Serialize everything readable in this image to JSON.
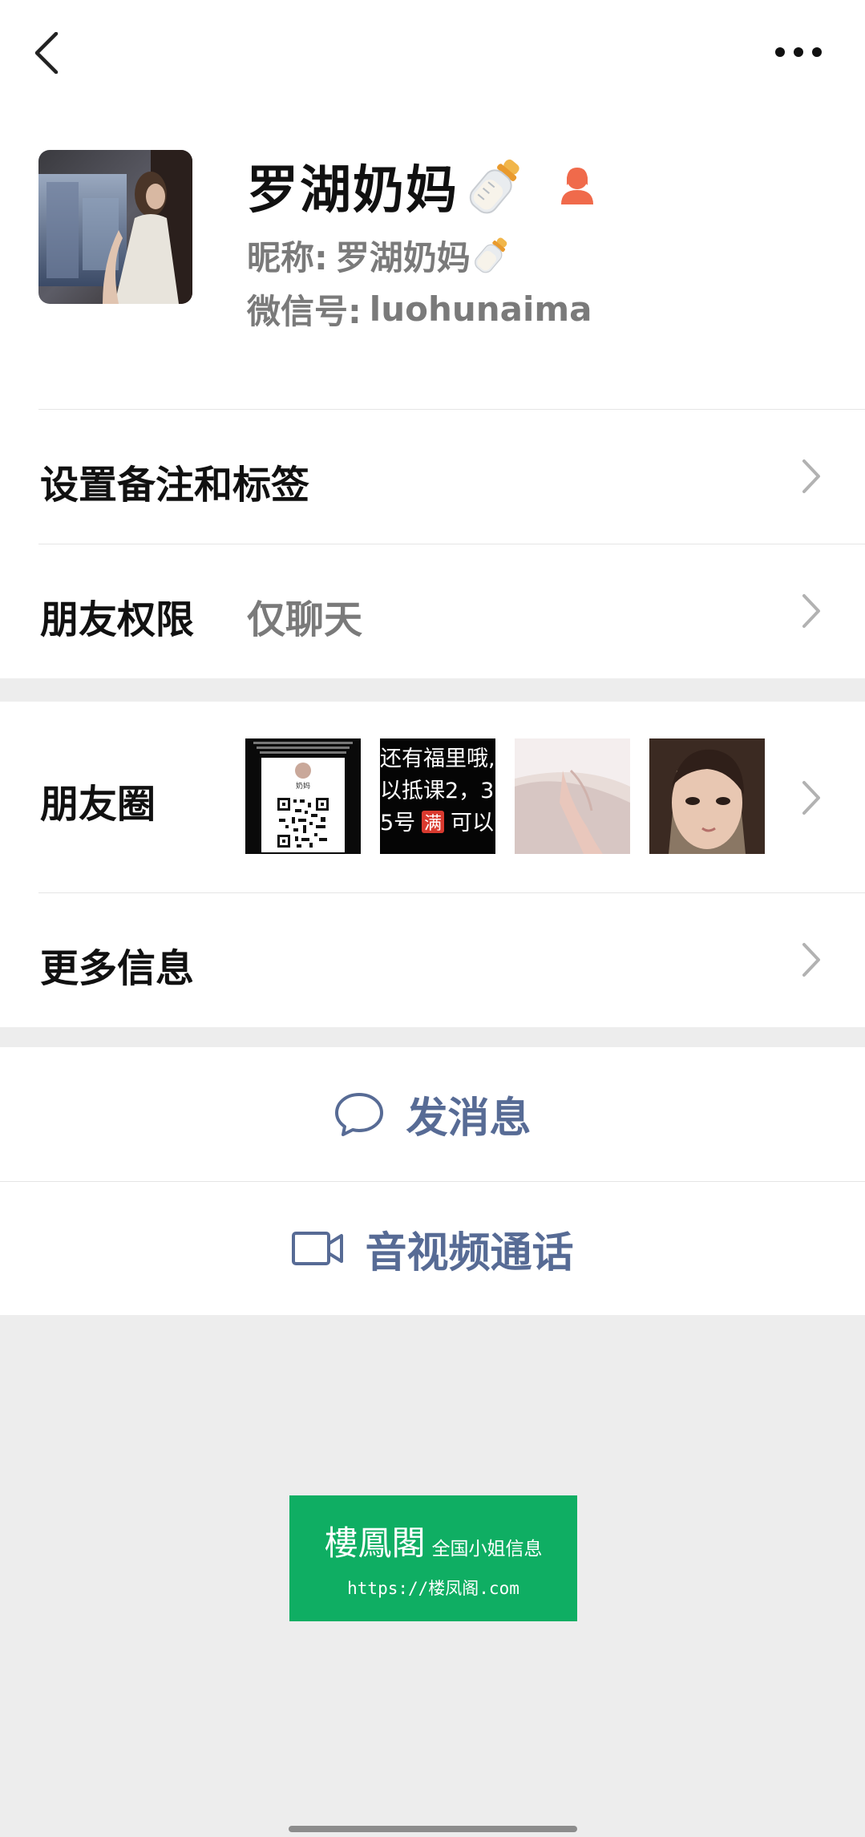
{
  "profile": {
    "display_name": "罗湖奶妈",
    "nickname_label": "昵称:",
    "nickname_value": "罗湖奶妈",
    "wechat_id_label": "微信号:",
    "wechat_id_value": "luohunaima",
    "gender_icon": "female-icon",
    "emoji_icon": "baby-bottle-icon"
  },
  "rows": {
    "remark_label": "设置备注和标签",
    "permission_label": "朋友权限",
    "permission_value": "仅聊天",
    "moments_label": "朋友圈",
    "more_info_label": "更多信息"
  },
  "moments_thumbs": [
    {
      "caption": "还有福里哦，以抵课2，3 5号满 可以"
    },
    {
      "caption": "扫码"
    }
  ],
  "thumb_text": {
    "t2_line1": "还有福里哦,",
    "t2_line2": "以抵课2，3",
    "t2_line3a": "5号",
    "t2_line3b": "满",
    "t2_line3c": "可以",
    "t1_name": "奶妈"
  },
  "actions": {
    "message_label": "发消息",
    "call_label": "音视频通话"
  },
  "ad": {
    "brand": "樓鳳閣",
    "subtitle": "全国小姐信息",
    "url": "https://楼凤阁.com"
  },
  "colors": {
    "accent_link": "#576b95",
    "gender_female": "#f06a4b",
    "ad_green": "#0fae63"
  }
}
